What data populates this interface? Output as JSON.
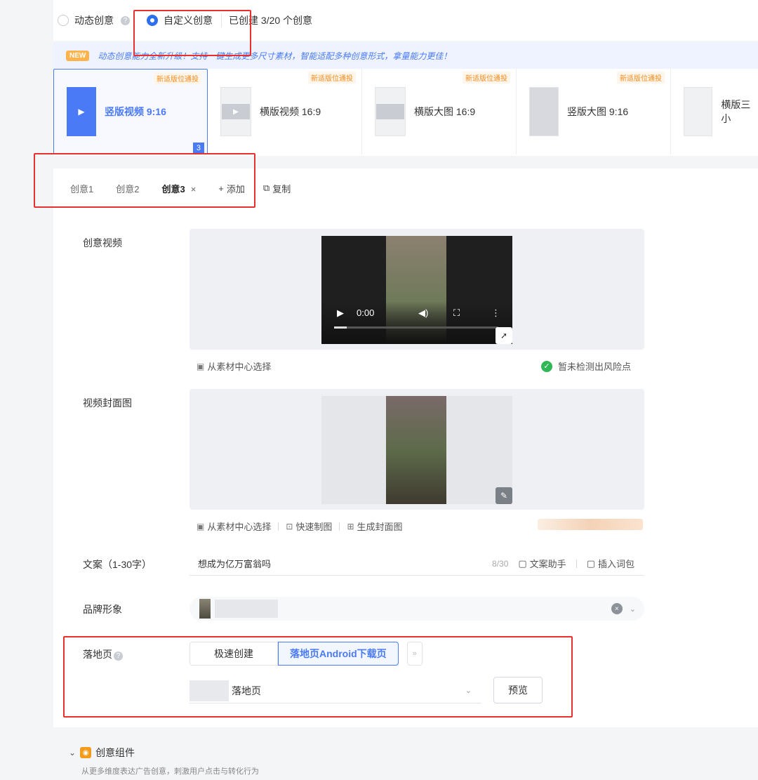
{
  "mode": {
    "dynamic_label": "动态创意",
    "custom_label": "自定义创意",
    "created_text": "已创建 3/20 个创意"
  },
  "banner": {
    "badge": "NEW",
    "text": "动态创意能力全新升级！支持一键生成更多尺寸素材，智能适配多种创意形式，拿量能力更佳！"
  },
  "formats": [
    {
      "tag": "新适版位通投",
      "label": "竖版视频 9:16",
      "count": "3"
    },
    {
      "tag": "新适版位通投",
      "label": "横版视频 16:9"
    },
    {
      "tag": "新适版位通投",
      "label": "横版大图 16:9"
    },
    {
      "tag": "新适版位通投",
      "label": "竖版大图 9:16"
    },
    {
      "tag": "",
      "label": "横版三小"
    }
  ],
  "tabs": {
    "items": [
      "创意1",
      "创意2",
      "创意3"
    ],
    "close": "×",
    "add": "添加",
    "copy": "复制"
  },
  "form": {
    "video_label": "创意视频",
    "video_time": "0:00",
    "from_library": "从素材中心选择",
    "risk_text": "暂未检测出风险点",
    "cover_label": "视频封面图",
    "quick_make": "快速制图",
    "gen_cover": "生成封面图",
    "copy_label": "文案（1-30字）",
    "copy_value": "想成为亿万富翁吗",
    "copy_counter": "8/30",
    "copy_assistant": "文案助手",
    "insert_words": "插入词包",
    "brand_label": "品牌形象",
    "landing_label": "落地页",
    "landing_options": [
      "极速创建",
      "落地页Android下载页"
    ],
    "landing_select_text": "落地页",
    "preview_btn": "预览"
  },
  "components": {
    "title": "创意组件",
    "desc": "从更多维度表达广告创意，刺激用户点击与转化行为"
  },
  "colors": {
    "accent": "#4a7af5",
    "annotation": "#e8302f",
    "tag": "#f08a1c"
  }
}
